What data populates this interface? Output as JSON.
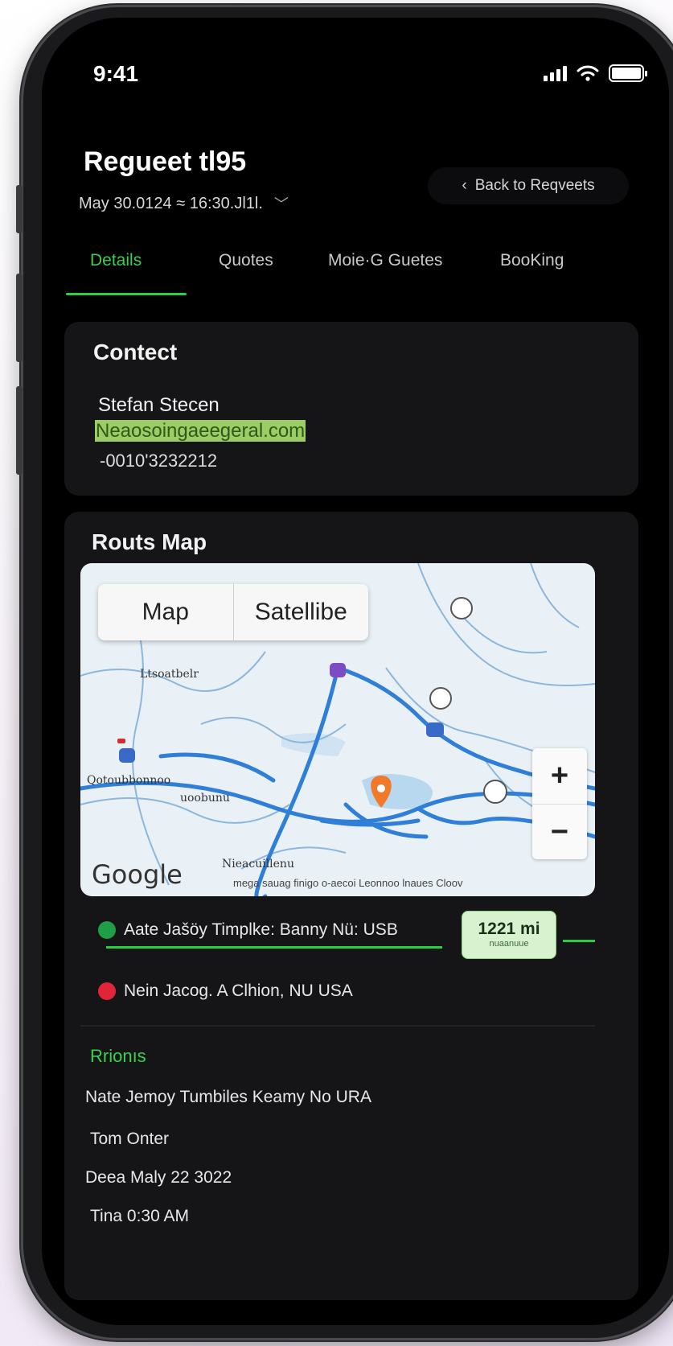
{
  "status_bar": {
    "time": "9:41"
  },
  "header": {
    "title": "Regueet tl95",
    "subtitle": "May 30.0124 ≈ 16:30.Jl1l.",
    "back_label": "Back to Reqveets"
  },
  "tabs": [
    {
      "label": "Details",
      "active": true
    },
    {
      "label": "Quotes",
      "active": false
    },
    {
      "label": "Moie·G Guetes",
      "active": false
    },
    {
      "label": "BooKing",
      "active": false
    }
  ],
  "contact": {
    "title": "Contect",
    "name": "Stefan Stecen",
    "email_highlight": "Neaosoingaeegeral.com",
    "email_rest": "",
    "phone": "-0010'3232212"
  },
  "route": {
    "title": "Routs Map",
    "map": {
      "toggle": [
        "Map",
        "Satellibe"
      ],
      "zoom_in": "+",
      "zoom_out": "−",
      "google": "Google",
      "labels": [
        "Ltsoatbelr",
        "Qotoubbonnoo",
        "uoobunu",
        "Nieacuillenu"
      ],
      "attribution": "mega sauag finigo o-aecoi Leonnoo lnaues Cloov"
    },
    "origin": "Aate Jašöy Timplke: Banny Nü: USB",
    "destination": "Nein Jacog. A Clhion, NU USA",
    "distance": {
      "value": "1221 mi",
      "sub": "nuaanuue"
    },
    "colors": {
      "accent": "#39d14f",
      "origin": "#1f9e47",
      "destination": "#e0253a",
      "pin": "#f07a2a"
    }
  },
  "options": {
    "label": "Rrionıs",
    "items": [
      "Nate Jemoy Tumbiles Keamy No URA",
      "Tom  Onter",
      "Deea Maly 22 3022",
      "Tina  0:30 AM"
    ]
  }
}
